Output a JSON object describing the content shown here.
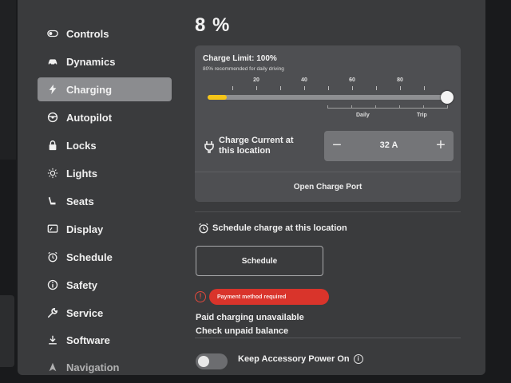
{
  "sidebar": {
    "items": [
      {
        "label": "Controls",
        "icon": "toggle-icon"
      },
      {
        "label": "Dynamics",
        "icon": "car-icon"
      },
      {
        "label": "Charging",
        "icon": "bolt-icon",
        "active": true
      },
      {
        "label": "Autopilot",
        "icon": "steering-wheel-icon"
      },
      {
        "label": "Locks",
        "icon": "lock-icon"
      },
      {
        "label": "Lights",
        "icon": "sun-icon"
      },
      {
        "label": "Seats",
        "icon": "seat-icon"
      },
      {
        "label": "Display",
        "icon": "display-icon"
      },
      {
        "label": "Schedule",
        "icon": "alarm-clock-icon"
      },
      {
        "label": "Safety",
        "icon": "info-circle-icon"
      },
      {
        "label": "Service",
        "icon": "wrench-icon"
      },
      {
        "label": "Software",
        "icon": "download-icon"
      },
      {
        "label": "Navigation",
        "icon": "navigation-arrow-icon"
      }
    ]
  },
  "charging": {
    "battery_percent": "8 %",
    "limit_title": "Charge Limit: 100%",
    "limit_subtitle": "80% recommended for daily driving",
    "scale_labels": [
      "20",
      "40",
      "60",
      "80"
    ],
    "charge_level_fraction": 0.08,
    "charge_limit_fraction": 1.0,
    "range_labels": {
      "daily": "Daily",
      "trip": "Trip"
    },
    "current_label": "Charge Current at this location",
    "current_value": "32 A",
    "minus": "−",
    "plus": "+",
    "open_port": "Open Charge Port",
    "accent_color": "#f5c518"
  },
  "schedule": {
    "title": "Schedule charge at this location",
    "button": "Schedule"
  },
  "payment": {
    "alert_icon": "!",
    "alert": "Payment method required",
    "alert_color": "#d9342b",
    "unavailable": "Paid charging unavailable",
    "check_balance": "Check unpaid balance"
  },
  "accessory": {
    "label": "Keep Accessory Power On",
    "info_icon": "i",
    "enabled": false
  }
}
